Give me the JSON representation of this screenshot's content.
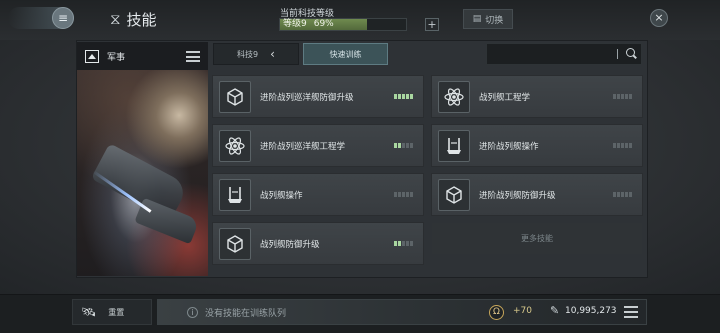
{
  "header": {
    "title": "技能",
    "tech_level_label": "当前科技等级",
    "level_text": "等级9",
    "level_percent_text": "69%",
    "level_fraction": 0.69,
    "add_label": "+",
    "switch_label": "切换",
    "close_label": "×"
  },
  "left_panel": {
    "category": "军事"
  },
  "tabs": {
    "tech_label": "科技9",
    "fast_training_label": "快速训练"
  },
  "search": {
    "placeholder": "",
    "value": ""
  },
  "skills": [
    {
      "name": "进阶战列巡洋舰防御升级",
      "icon": "cube-icon",
      "level": 5,
      "max": 5
    },
    {
      "name": "战列舰工程学",
      "icon": "atom-icon",
      "level": 0,
      "max": 5
    },
    {
      "name": "进阶战列巡洋舰工程学",
      "icon": "atom-icon",
      "level": 2,
      "max": 5
    },
    {
      "name": "进阶战列舰操作",
      "icon": "ship-icon",
      "level": 0,
      "max": 5
    },
    {
      "name": "战列舰操作",
      "icon": "ship-icon",
      "level": 0,
      "max": 5
    },
    {
      "name": "进阶战列舰防御升级",
      "icon": "cube-icon",
      "level": 0,
      "max": 5
    },
    {
      "name": "战列舰防御升级",
      "icon": "cube-icon",
      "level": 2,
      "max": 5
    }
  ],
  "more_skills_label": "更多技能",
  "bottom": {
    "reset_label": "重置",
    "queue_text": "没有技能在训练队列",
    "omega_bonus": "+70",
    "skill_points": "10,995,273"
  },
  "colors": {
    "pip_on": "#a9d7a0",
    "pip_off": "#5d6468",
    "accent_tab": "#3c5358",
    "level_bar": "#6f8a4f"
  }
}
